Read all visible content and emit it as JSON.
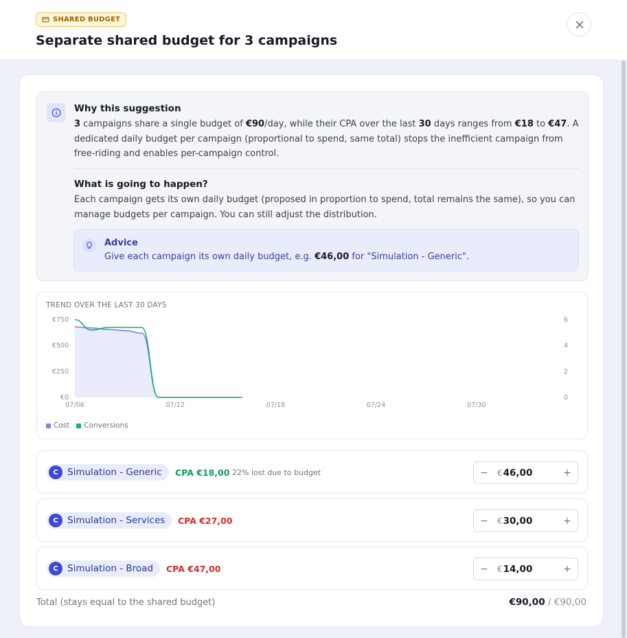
{
  "header": {
    "badge": "SHARED BUDGET",
    "title": "Separate shared budget for 3 campaigns"
  },
  "why": {
    "title": "Why this suggestion",
    "campaign_count": "3",
    "text_1": " campaigns share a single budget of ",
    "shared_budget": "€90",
    "text_2": "/day, while their CPA over the last ",
    "days": "30",
    "text_3": " days ranges from ",
    "cpa_min": "€18",
    "text_4": " to ",
    "cpa_max": "€47",
    "text_5": ". A dedicated daily budget per campaign (proportional to spend, same total) stops the inefficient campaign from free-riding and enables per-campaign control."
  },
  "happen": {
    "title": "What is going to happen?",
    "text": "Each campaign gets its own daily budget (proposed in proportion to spend, total remains the same), so you can manage budgets per campaign. You can still adjust the distribution."
  },
  "advice": {
    "title": "Advice",
    "text_1": "Give each campaign its own daily budget, e.g. ",
    "amount": "€46,00",
    "text_2": " for \"Simulation - Generic\"."
  },
  "chart_data": {
    "type": "line",
    "title": "TREND OVER THE LAST 30 DAYS",
    "x_ticks": [
      "07/06",
      "07/12",
      "07/18",
      "07/24",
      "07/30"
    ],
    "y_left_ticks": [
      "€0",
      "€250",
      "€500",
      "€750"
    ],
    "y_left_lim": [
      0,
      750
    ],
    "y_right_ticks": [
      "0",
      "2",
      "4",
      "6"
    ],
    "y_right_lim": [
      0,
      6
    ],
    "x": [
      "07/06",
      "07/07",
      "07/08",
      "07/09",
      "07/10",
      "07/11",
      "07/12",
      "07/13",
      "07/14",
      "07/15",
      "07/16"
    ],
    "series": [
      {
        "name": "Cost",
        "axis": "left",
        "color": "#7f83e6",
        "fill": true,
        "values": [
          680,
          670,
          655,
          645,
          620,
          0,
          0,
          0,
          0,
          0,
          0
        ]
      },
      {
        "name": "Conversions",
        "axis": "right",
        "color": "#16b07d",
        "fill": false,
        "values": [
          6,
          5.2,
          5.4,
          5.4,
          5.4,
          0,
          0,
          0,
          0,
          0,
          0
        ]
      }
    ],
    "legend": [
      "Cost",
      "Conversions"
    ],
    "legend_position": "bottom-left",
    "grid": false
  },
  "campaigns": [
    {
      "letter": "C",
      "name": "Simulation - Generic",
      "cpa": "CPA €18,00",
      "cpa_color": "#139a5e",
      "lost": "22% lost due to budget",
      "currency": "€",
      "budget": "46,00"
    },
    {
      "letter": "C",
      "name": "Simulation - Services",
      "cpa": "CPA €27,00",
      "cpa_color": "#d22b2b",
      "lost": "",
      "currency": "€",
      "budget": "30,00"
    },
    {
      "letter": "C",
      "name": "Simulation - Broad",
      "cpa": "CPA €47,00",
      "cpa_color": "#d22b2b",
      "lost": "",
      "currency": "€",
      "budget": "14,00"
    }
  ],
  "stepper": {
    "minus": "−",
    "plus": "+"
  },
  "total": {
    "label": "Total (stays equal to the shared budget)",
    "value": "€90,00",
    "separator": " / ",
    "shared": "€90,00"
  },
  "colors": {
    "accent": "#3e4ad1",
    "badge_bg": "#fff6dc",
    "cost": "#7f83e6",
    "conversions": "#16b07d"
  },
  "icons": {
    "badge": "wallet-icon",
    "close": "close-icon",
    "info": "info-icon",
    "advice": "lightbulb-icon"
  }
}
